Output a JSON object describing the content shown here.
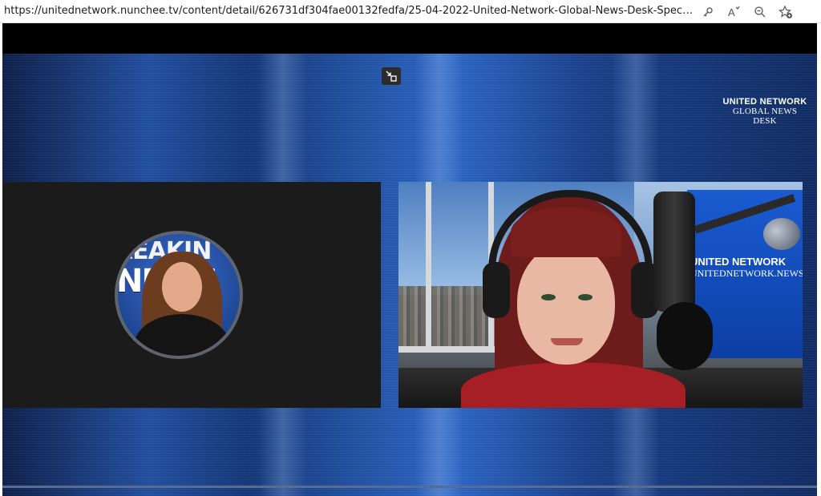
{
  "browser": {
    "url": "https://unitednetwork.nunchee.tv/content/detail/626731df304fae00132fedfa/25-04-2022-United-Network-Global-News-Desk-Special-Report-with-Sunny...",
    "icons": [
      "key-icon",
      "read-aloud-icon",
      "zoom-icon",
      "add-favorite-icon"
    ]
  },
  "player": {
    "exit_fullscreen_icon": "exit-fullscreen-icon"
  },
  "logo": {
    "line1": "UNITED NETWORK",
    "line2": "GLOBAL NEWS DESK"
  },
  "left_panel": {
    "backdrop_word_top": "REAKIN",
    "backdrop_word": "NEWS"
  },
  "right_panel": {
    "backdrop_line1": "UNITED NETWORK",
    "backdrop_line2": "UNITEDNETWORK.NEWS"
  },
  "colors": {
    "stage_blue": "#1f4ea0",
    "panel_dark": "#1b1b1b",
    "host_top": "#a51f24"
  }
}
